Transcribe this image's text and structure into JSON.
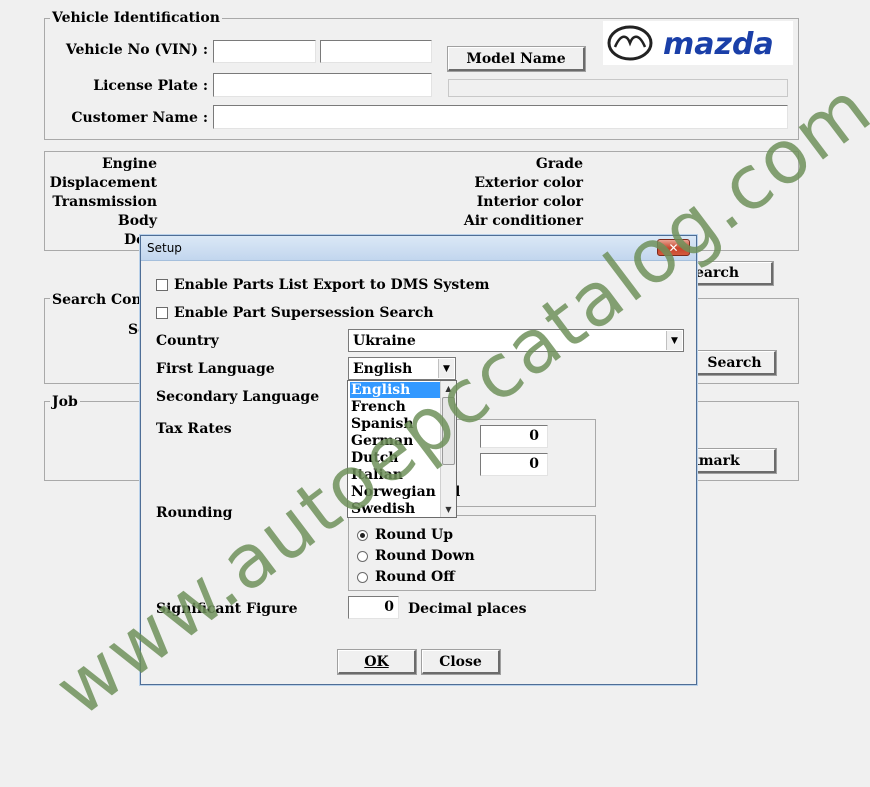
{
  "vehicle_identification": {
    "title": "Vehicle Identification",
    "vin_label": "Vehicle No (VIN) :",
    "vin_value_1": "",
    "vin_value_2": "",
    "model_name_button": "Model Name",
    "license_plate_label": "License Plate :",
    "license_plate_value": "",
    "customer_name_label": "Customer Name :",
    "customer_name_value": ""
  },
  "brand": {
    "logo_text": "mazda",
    "logo_color": "#1a3fa8"
  },
  "specs": {
    "left": [
      "Engine",
      "Displacement",
      "Transmission",
      "Body",
      "Do"
    ],
    "right": [
      "Grade",
      "Exterior color",
      "Interior color",
      "Air conditioner"
    ]
  },
  "search_conditions": {
    "title": "Search Condi",
    "label_partial": "Se",
    "search_button_top": "earch",
    "search_button": "Search"
  },
  "job": {
    "title": "Job",
    "bookmark_button": "kmark"
  },
  "setup_dialog": {
    "title": "Setup",
    "close_glyph": "✕",
    "enable_parts_export": "Enable Parts List Export to DMS System",
    "enable_supersession": "Enable Part Supersession Search",
    "country_label": "Country",
    "country_value": "Ukraine",
    "first_language_label": "First Language",
    "first_language_value": "English",
    "secondary_language_label": "Secondary Language",
    "tax_rates_label": "Tax Rates",
    "tax_rate_1": "0",
    "tax_rate_2": "0",
    "tax_partial_label": "l",
    "rounding_label": "Rounding",
    "rounding_options": [
      "Round Up",
      "Round Down",
      "Round Off"
    ],
    "rounding_selected": "Round Up",
    "significant_figure_label": "Significant Figure",
    "significant_figure_value": "0",
    "decimal_places_label": "Decimal places",
    "ok_button": "OK",
    "close_button": "Close"
  },
  "language_dropdown": {
    "options": [
      "English",
      "French",
      "Spanish",
      "German",
      "Dutch",
      "Italian",
      "Norwegian",
      "Swedish"
    ],
    "selected": "English"
  },
  "watermark": {
    "text": "www.autoepccatalog.com",
    "color": "#6e915a"
  }
}
